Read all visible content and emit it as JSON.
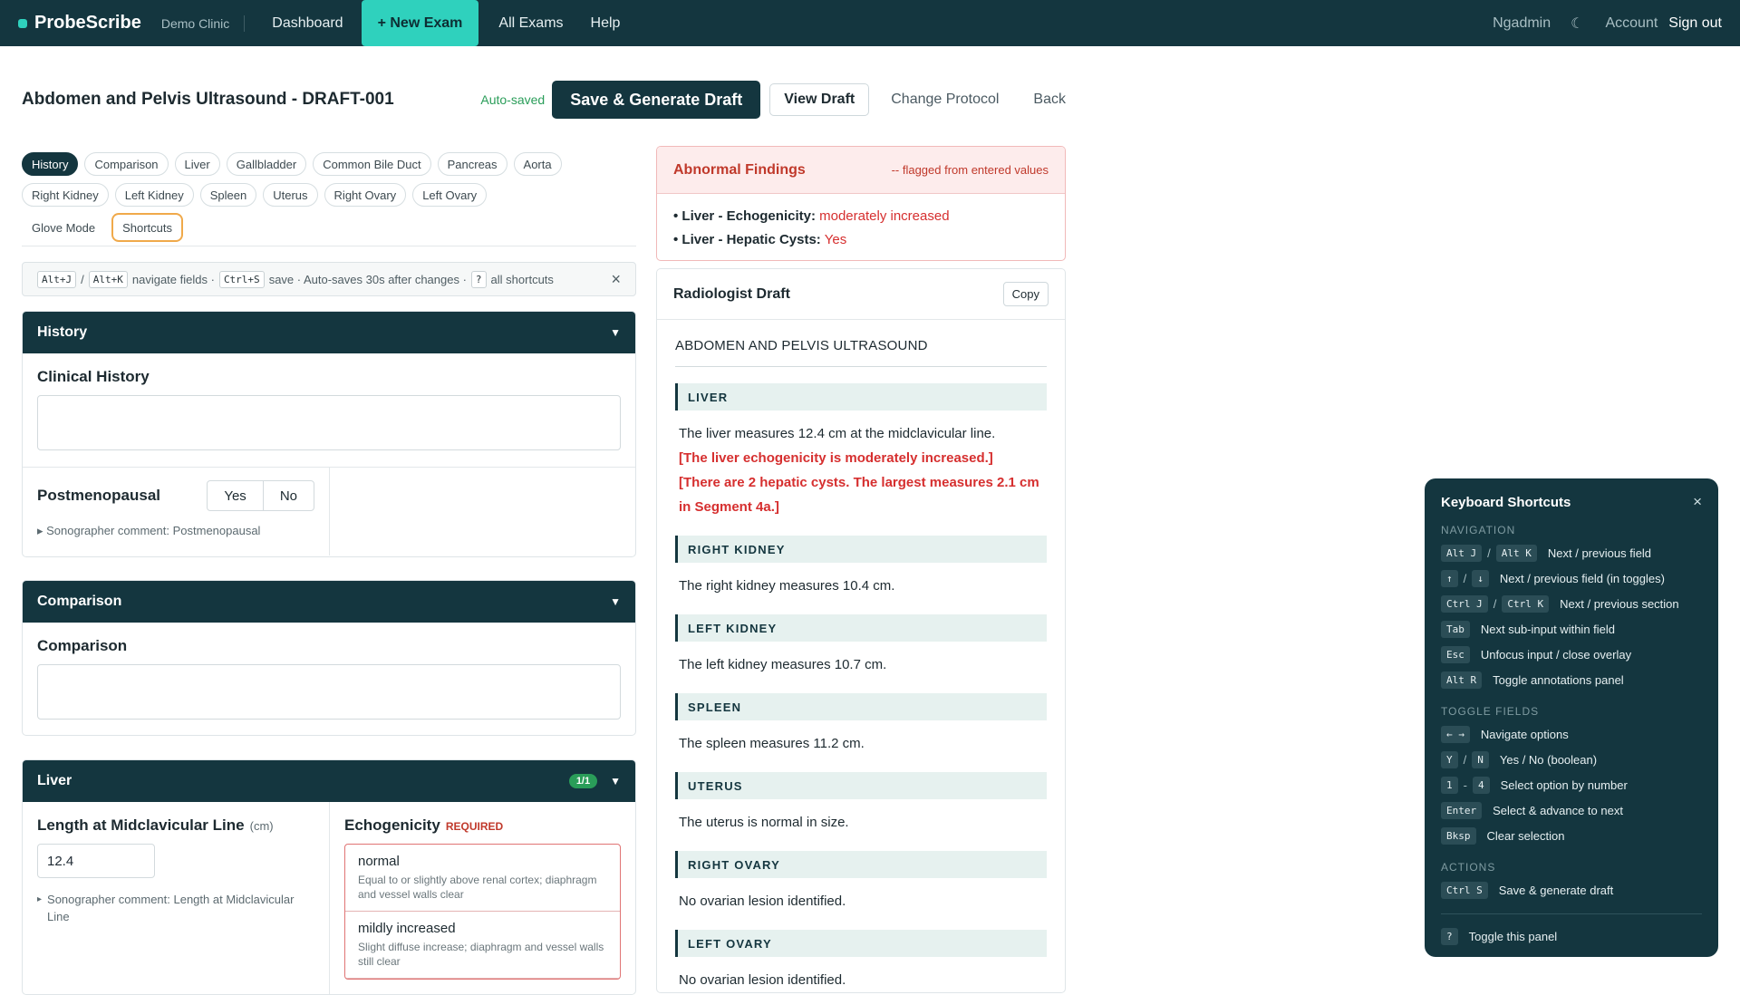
{
  "topbar": {
    "brand": "ProbeScribe",
    "clinic": "Demo Clinic",
    "nav": [
      "Dashboard",
      "+ New Exam",
      "All Exams",
      "Help"
    ],
    "user": "Ngadmin",
    "theme_icon": "moon-icon",
    "account": "Account",
    "signout": "Sign out",
    "accent": "#2fd1bd",
    "background": "#14363f"
  },
  "header": {
    "title": "Abdomen and Pelvis Ultrasound - DRAFT-001",
    "autosaved": "Auto-saved",
    "save_label": "Save & Generate Draft",
    "view_draft": "View Draft",
    "change_protocol": "Change Protocol",
    "back": "Back"
  },
  "chips": {
    "row1": [
      "History",
      "Comparison",
      "Liver",
      "Gallbladder",
      "Common Bile Duct",
      "Pancreas",
      "Aorta"
    ],
    "row2": [
      "Right Kidney",
      "Left Kidney",
      "Spleen",
      "Uterus",
      "Right Ovary",
      "Left Ovary"
    ],
    "row3": [
      "Glove Mode",
      "Shortcuts"
    ]
  },
  "hint": {
    "k1": "Alt+J",
    "slash": "/",
    "k2": "Alt+K",
    "t1": "navigate fields ·",
    "k3": "Ctrl+S",
    "t2": "save · Auto-saves 30s after changes ·",
    "k4": "?",
    "t3": "all shortcuts",
    "close": "×"
  },
  "history": {
    "title": "History",
    "caret": "▼",
    "clinical_history": "Clinical History",
    "postmeno": "Postmenopausal",
    "yes": "Yes",
    "no": "No",
    "comment": "▸ Sonographer comment: Postmenopausal"
  },
  "comparison": {
    "title": "Comparison",
    "caret": "▼",
    "label": "Comparison"
  },
  "liver": {
    "title": "Liver",
    "badge": "1/1",
    "caret": "▼",
    "length_label": "Length at Midclavicular Line",
    "length_unit": "(cm)",
    "length_value": "12.4",
    "length_comment_arrow": "▸",
    "length_comment": "Sonographer comment: Length at Midclavicular Line",
    "echo_label": "Echogenicity",
    "echo_required": "REQUIRED",
    "options": [
      {
        "name": "normal",
        "desc": "Equal to or slightly above renal cortex; diaphragm and vessel walls clear"
      },
      {
        "name": "mildly increased",
        "desc": "Slight diffuse increase; diaphragm and vessel walls still clear"
      }
    ]
  },
  "abnormal": {
    "title": "Abnormal Findings",
    "subtitle": "-- flagged from entered values",
    "items": [
      {
        "label": "• Liver - Echogenicity:",
        "value": "moderately increased"
      },
      {
        "label": "• Liver - Hepatic Cysts:",
        "value": "Yes"
      }
    ],
    "color": "#d62f2f"
  },
  "draft": {
    "title": "Radiologist Draft",
    "copy": "Copy",
    "heading": "ABDOMEN AND PELVIS ULTRASOUND",
    "sections": [
      {
        "name": "LIVER",
        "text": "The liver measures 12.4 cm at the midclavicular line.",
        "flag1": "[The liver echogenicity is moderately increased.]",
        "flag2": "[There are 2 hepatic cysts. The largest measures 2.1 cm in Segment 4a.]"
      },
      {
        "name": "RIGHT KIDNEY",
        "text": "The right kidney measures 10.4 cm."
      },
      {
        "name": "LEFT KIDNEY",
        "text": "The left kidney measures 10.7 cm."
      },
      {
        "name": "SPLEEN",
        "text": "The spleen measures 11.2 cm."
      },
      {
        "name": "UTERUS",
        "text": "The uterus is normal in size."
      },
      {
        "name": "RIGHT OVARY",
        "text": "No ovarian lesion identified."
      },
      {
        "name": "LEFT OVARY",
        "text": "No ovarian lesion identified."
      }
    ]
  },
  "shortcuts": {
    "title": "Keyboard Shortcuts",
    "close": "×",
    "navigation_label": "NAVIGATION",
    "navigation": [
      {
        "k1": "Alt J",
        "k2": "Alt K",
        "desc": "Next / previous field"
      },
      {
        "k1": "↑",
        "k2": "↓",
        "desc": "Next / previous field (in toggles)"
      },
      {
        "k1": "Ctrl J",
        "k2": "Ctrl K",
        "desc": "Next / previous section"
      },
      {
        "k1": "Tab",
        "desc": "Next sub-input within field"
      },
      {
        "k1": "Esc",
        "desc": "Unfocus input / close overlay"
      },
      {
        "k1": "Alt R",
        "desc": "Toggle annotations panel"
      }
    ],
    "toggle_label": "TOGGLE FIELDS",
    "toggle": [
      {
        "k1": "← →",
        "desc": "Navigate options"
      },
      {
        "k1": "Y",
        "k2": "N",
        "desc": "Yes / No (boolean)"
      },
      {
        "k1": "1",
        "k2": "4",
        "sep": "-",
        "desc": "Select option by number"
      },
      {
        "k1": "Enter",
        "desc": "Select & advance to next"
      },
      {
        "k1": "Bksp",
        "desc": "Clear selection"
      }
    ],
    "actions_label": "ACTIONS",
    "actions": [
      {
        "k1": "Ctrl S",
        "desc": "Save & generate draft"
      }
    ],
    "footer": {
      "k1": "?",
      "desc": "Toggle this panel"
    }
  }
}
